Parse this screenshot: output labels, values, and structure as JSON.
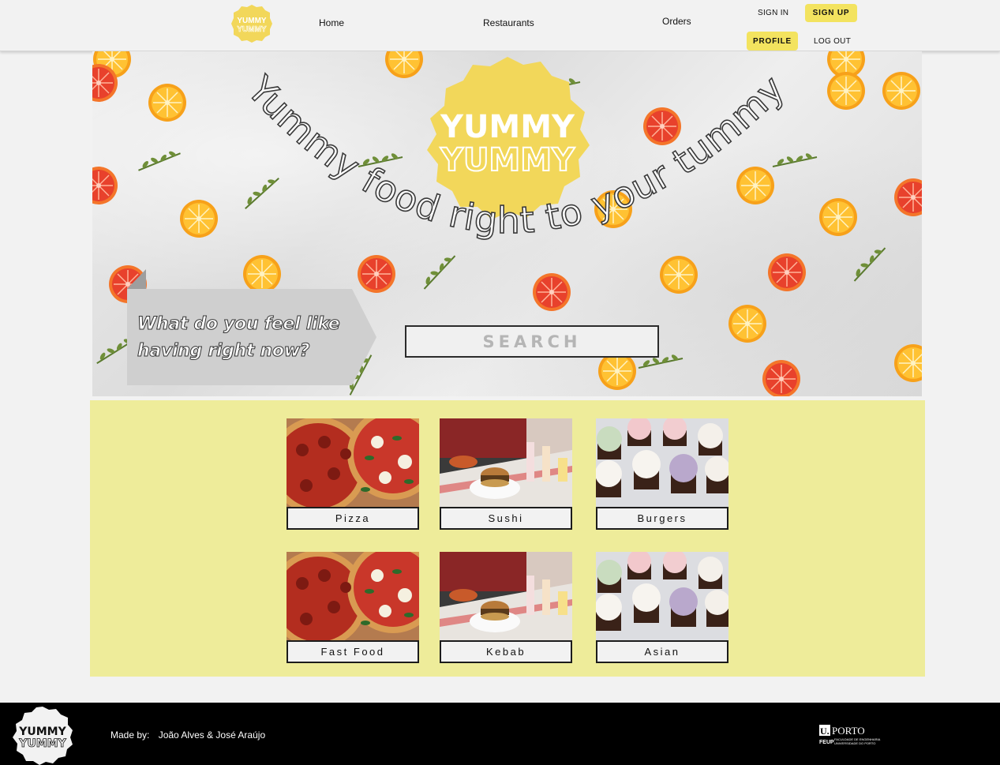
{
  "brand": {
    "line1": "YUMMY",
    "line2": "YUMMY",
    "color": "#f2d75a"
  },
  "nav": {
    "home": "Home",
    "restaurants": "Restaurants",
    "orders": "Orders"
  },
  "auth": {
    "sign_in": "SIGN IN",
    "sign_up": "SIGN UP",
    "profile": "PROFILE",
    "log_out": "LOG OUT"
  },
  "hero": {
    "tagline": "Yummy food right to your tummy",
    "prompt_line1": "What do you feel like",
    "prompt_line2": "having right now?",
    "search_placeholder": "SEARCH"
  },
  "categories": [
    {
      "label": "Pizza",
      "icon": "pizza-photo"
    },
    {
      "label": "Sushi",
      "icon": "diner-burger-photo"
    },
    {
      "label": "Burgers",
      "icon": "cupcakes-photo"
    },
    {
      "label": "Fast Food",
      "icon": "pizza-photo"
    },
    {
      "label": "Kebab",
      "icon": "diner-burger-photo"
    },
    {
      "label": "Asian",
      "icon": "cupcakes-photo"
    }
  ],
  "footer": {
    "made_by_label": "Made by:",
    "authors": "João Alves & José Araújo",
    "uporto_top": "PORTO",
    "uporto_letter": "U.",
    "feup": "FEUP",
    "feup_line1": "FACULDADE DE ENGENHARIA",
    "feup_line2": "UNIVERSIDADE DO PORTO"
  },
  "colors": {
    "accent": "#f3e35f",
    "category_bg": "#eeec9a",
    "footer_bg": "#000000"
  }
}
